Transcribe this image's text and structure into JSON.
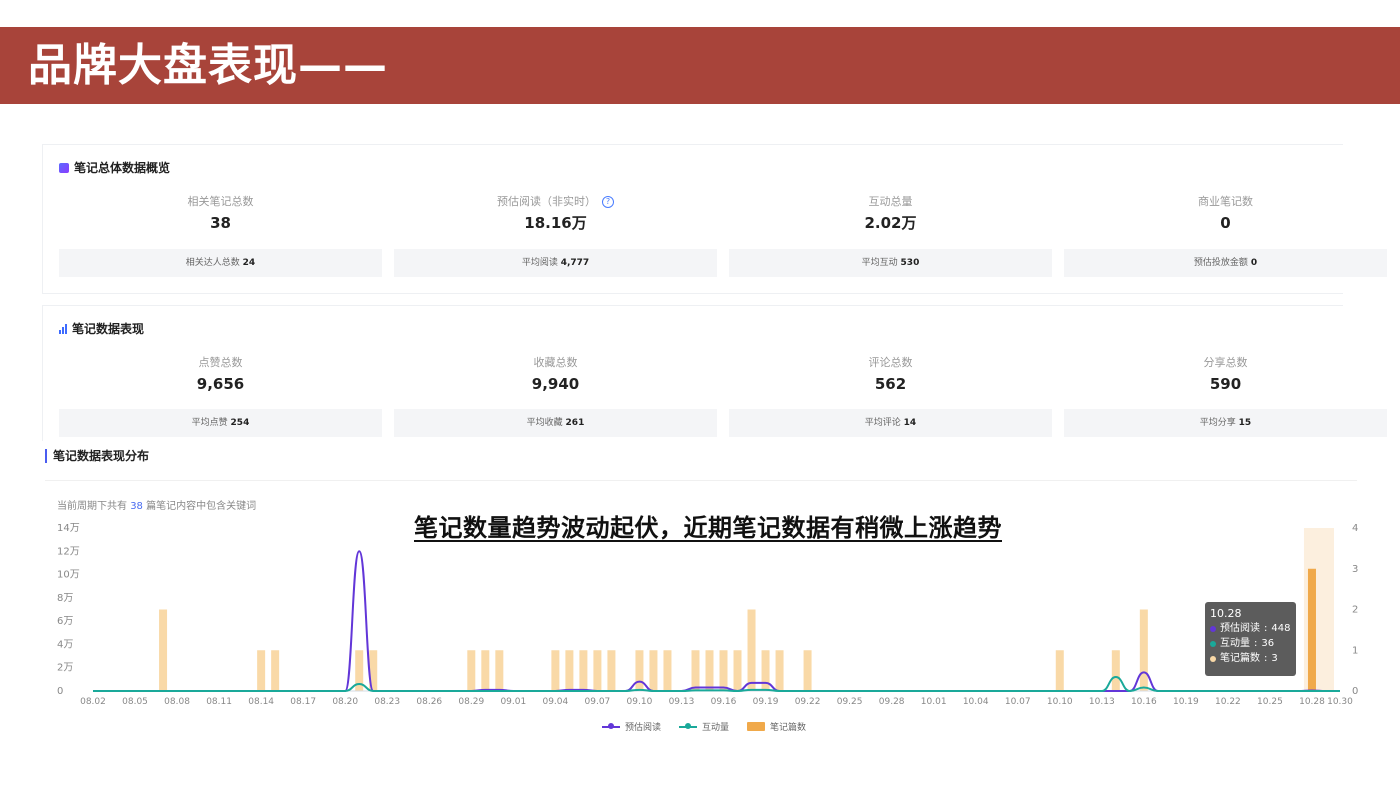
{
  "header": {
    "title": "品牌大盘表现——"
  },
  "overview": {
    "title": "笔记总体数据概览",
    "metrics": [
      {
        "label": "相关笔记总数",
        "value": "38",
        "sub_label": "相关达人总数",
        "sub_value": "24"
      },
      {
        "label": "预估阅读（非实时）",
        "value": "18.16万",
        "sub_label": "平均阅读",
        "sub_value": "4,777"
      },
      {
        "label": "互动总量",
        "value": "2.02万",
        "sub_label": "平均互动",
        "sub_value": "530"
      },
      {
        "label": "商业笔记数",
        "value": "0",
        "sub_label": "预估投放金额",
        "sub_value": "0"
      }
    ]
  },
  "performance": {
    "title": "笔记数据表现",
    "metrics": [
      {
        "label": "点赞总数",
        "value": "9,656",
        "sub_label": "平均点赞",
        "sub_value": "254"
      },
      {
        "label": "收藏总数",
        "value": "9,940",
        "sub_label": "平均收藏",
        "sub_value": "261"
      },
      {
        "label": "评论总数",
        "value": "562",
        "sub_label": "平均评论",
        "sub_value": "14"
      },
      {
        "label": "分享总数",
        "value": "590",
        "sub_label": "平均分享",
        "sub_value": "15"
      }
    ]
  },
  "distribution": {
    "title": "笔记数据表现分布",
    "note_prefix": "当前周期下共有",
    "note_count": "38",
    "note_suffix": "篇笔记内容中包含关键词"
  },
  "overlay_text": "笔记数量趋势波动起伏，近期笔记数据有稍微上涨趋势",
  "tooltip": {
    "date": "10.28",
    "rows": [
      {
        "label": "预估阅读",
        "value": "448"
      },
      {
        "label": "互动量",
        "value": "36"
      },
      {
        "label": "笔记篇数",
        "value": "3"
      }
    ]
  },
  "colors": {
    "banner": "#a8443a",
    "read": "#6236d8",
    "interact": "#1aa99a",
    "notes": "#f9d9a7",
    "notes_highlight": "#f0a94a"
  },
  "chart_data": {
    "type": "line",
    "x": [
      "08.02",
      "08.03",
      "08.04",
      "08.05",
      "08.06",
      "08.07",
      "08.08",
      "08.09",
      "08.10",
      "08.11",
      "08.12",
      "08.13",
      "08.14",
      "08.15",
      "08.16",
      "08.17",
      "08.18",
      "08.19",
      "08.20",
      "08.21",
      "08.22",
      "08.23",
      "08.24",
      "08.25",
      "08.26",
      "08.27",
      "08.28",
      "08.29",
      "08.30",
      "08.31",
      "09.01",
      "09.02",
      "09.03",
      "09.04",
      "09.05",
      "09.06",
      "09.07",
      "09.08",
      "09.09",
      "09.10",
      "09.11",
      "09.12",
      "09.13",
      "09.14",
      "09.15",
      "09.16",
      "09.17",
      "09.18",
      "09.19",
      "09.20",
      "09.21",
      "09.22",
      "09.23",
      "09.24",
      "09.25",
      "09.26",
      "09.27",
      "09.28",
      "09.29",
      "09.30",
      "10.01",
      "10.02",
      "10.03",
      "10.04",
      "10.05",
      "10.06",
      "10.07",
      "10.08",
      "10.09",
      "10.10",
      "10.11",
      "10.12",
      "10.13",
      "10.14",
      "10.15",
      "10.16",
      "10.17",
      "10.18",
      "10.19",
      "10.20",
      "10.21",
      "10.22",
      "10.23",
      "10.24",
      "10.25",
      "10.26",
      "10.27",
      "10.28",
      "10.29",
      "10.30"
    ],
    "x_tick_labels": [
      "08.02",
      "08.05",
      "08.08",
      "08.11",
      "08.14",
      "08.17",
      "08.20",
      "08.23",
      "08.26",
      "08.29",
      "09.01",
      "09.04",
      "09.07",
      "09.10",
      "09.13",
      "09.16",
      "09.19",
      "09.22",
      "09.25",
      "09.28",
      "10.01",
      "10.04",
      "10.07",
      "10.10",
      "10.13",
      "10.16",
      "10.19",
      "10.22",
      "10.25",
      "10.28",
      "10.30"
    ],
    "y_left": {
      "ticks": [
        "0",
        "2万",
        "4万",
        "6万",
        "8万",
        "10万",
        "12万",
        "14万"
      ],
      "range": [
        0,
        140000
      ]
    },
    "y_right": {
      "ticks": [
        "0",
        "1",
        "2",
        "3",
        "4"
      ],
      "range": [
        0,
        4
      ]
    },
    "series": [
      {
        "name": "预估阅读",
        "axis": "left",
        "values": [
          0,
          0,
          0,
          0,
          0,
          0,
          0,
          0,
          0,
          0,
          0,
          0,
          0,
          0,
          0,
          0,
          0,
          0,
          0,
          120000,
          0,
          0,
          0,
          0,
          0,
          0,
          0,
          0,
          1000,
          1000,
          0,
          0,
          0,
          0,
          1000,
          1000,
          0,
          0,
          0,
          8000,
          0,
          0,
          0,
          3000,
          3000,
          3000,
          0,
          7000,
          7000,
          0,
          0,
          0,
          0,
          0,
          0,
          0,
          0,
          0,
          0,
          0,
          0,
          0,
          0,
          0,
          0,
          0,
          0,
          0,
          0,
          0,
          0,
          0,
          0,
          0,
          0,
          16000,
          0,
          0,
          0,
          0,
          0,
          0,
          0,
          0,
          0,
          0,
          0,
          448,
          0,
          0
        ]
      },
      {
        "name": "互动量",
        "axis": "left",
        "values": [
          0,
          0,
          0,
          0,
          0,
          0,
          0,
          0,
          0,
          0,
          0,
          0,
          0,
          0,
          0,
          0,
          0,
          0,
          0,
          6000,
          0,
          0,
          0,
          0,
          0,
          0,
          0,
          0,
          0,
          0,
          0,
          0,
          0,
          0,
          0,
          0,
          0,
          0,
          0,
          1000,
          0,
          0,
          0,
          500,
          500,
          500,
          0,
          1000,
          1000,
          0,
          0,
          0,
          0,
          0,
          0,
          0,
          0,
          0,
          0,
          0,
          0,
          0,
          0,
          0,
          0,
          0,
          0,
          0,
          0,
          0,
          0,
          0,
          0,
          12000,
          0,
          3000,
          0,
          0,
          0,
          0,
          0,
          0,
          0,
          0,
          0,
          0,
          0,
          36,
          0,
          0
        ]
      },
      {
        "name": "笔记篇数",
        "axis": "right",
        "type": "bar",
        "values": [
          0,
          0,
          0,
          0,
          0,
          2,
          0,
          0,
          0,
          0,
          0,
          0,
          1,
          1,
          0,
          0,
          0,
          0,
          0,
          1,
          1,
          0,
          0,
          0,
          0,
          0,
          0,
          1,
          1,
          1,
          0,
          0,
          0,
          1,
          1,
          1,
          1,
          1,
          0,
          1,
          1,
          1,
          0,
          1,
          1,
          1,
          1,
          2,
          1,
          1,
          0,
          1,
          0,
          0,
          0,
          0,
          0,
          0,
          0,
          0,
          0,
          0,
          0,
          0,
          0,
          0,
          0,
          0,
          0,
          1,
          0,
          0,
          0,
          1,
          0,
          2,
          0,
          0,
          0,
          0,
          0,
          0,
          0,
          0,
          0,
          0,
          0,
          3,
          0,
          0
        ]
      }
    ]
  }
}
